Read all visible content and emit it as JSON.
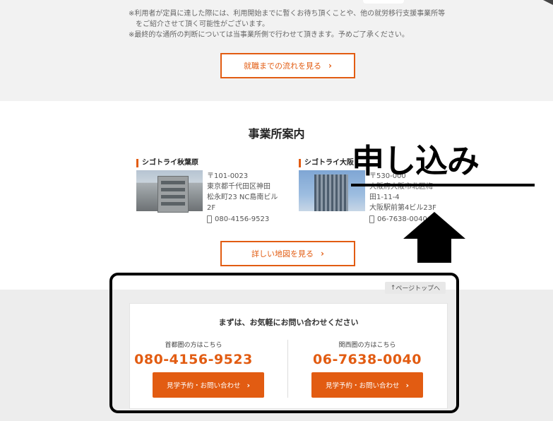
{
  "notes": [
    "※利用者が定員に達した際には、利用開始までに暫くお待ち頂くことや、他の就労移行支援事業所等",
    "　をご紹介させて頂く可能性がございます。",
    "※最終的な通所の判断については当事業所側で行わせて頂きます。予めご了承ください。"
  ],
  "flow_button": {
    "label": "就職までの流れを見る",
    "chevron": "›"
  },
  "offices_section": {
    "title": "事業所案内",
    "offices": [
      {
        "name": "シゴトライ秋葉原",
        "address": [
          "〒101-0023",
          "東京都千代田区神田",
          "松永町23 NC島南ビル",
          "2F"
        ],
        "tel": "080-4156-9523"
      },
      {
        "name": "シゴトライ大阪",
        "address": [
          "〒530-000",
          "大阪府大阪市北区梅",
          "田1-11-4",
          "大阪駅前第4ビル23F"
        ],
        "tel": "06-7638-0040"
      }
    ],
    "map_button": {
      "label": "詳しい地図を見る",
      "chevron": "›"
    }
  },
  "overlay": {
    "text": "申し込み"
  },
  "page_top": {
    "label": "ページトップへ",
    "arrow": "↑"
  },
  "contact": {
    "title": "まずは、お気軽にお問い合わせください",
    "regions": [
      {
        "label": "首都圏の方はこちら",
        "phone": "080-4156-9523",
        "button": "見学予約・お問い合わせ"
      },
      {
        "label": "関西圏の方はこちら",
        "phone": "06-7638-0040",
        "button": "見学予約・お問い合わせ"
      }
    ],
    "chevron": "›"
  },
  "colors": {
    "accent": "#e25c12",
    "gray_bg": "#f2f2f2"
  }
}
